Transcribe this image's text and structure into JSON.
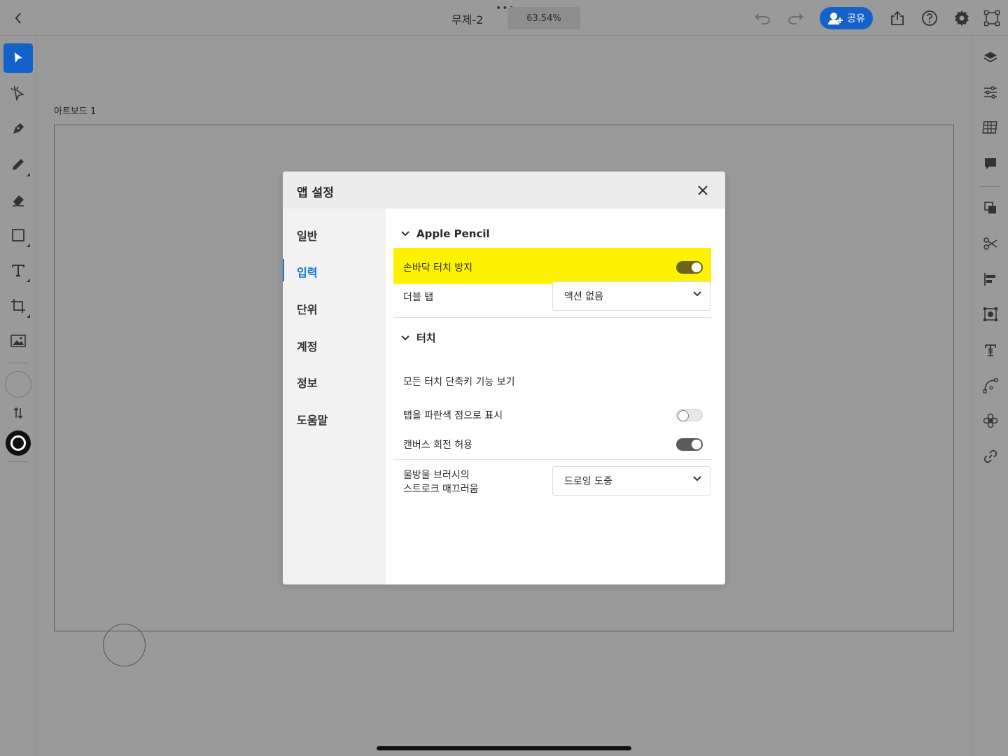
{
  "topbar": {
    "title": "무제-2",
    "more": "•••",
    "zoom": "63.54%",
    "share_label": "공유"
  },
  "canvas": {
    "artboard_label": "아트보드 1"
  },
  "dialog": {
    "title": "앱 설정",
    "nav": [
      "일반",
      "입력",
      "단위",
      "계정",
      "정보",
      "도움말"
    ],
    "active_nav": "입력",
    "sections": {
      "apple_pencil": {
        "title": "Apple Pencil",
        "palm_rejection_label": "손바닥 터치 방지",
        "palm_rejection_on": true,
        "double_tap_label": "더블 탭",
        "double_tap_value": "액션 없음"
      },
      "touch": {
        "title": "터치",
        "view_shortcuts_label": "모든 터치 단축키 기능 보기",
        "show_taps_label": "탭을 파란색 점으로 표시",
        "show_taps_on": false,
        "canvas_rotation_label": "캔버스 회전 허용",
        "canvas_rotation_on": true,
        "smoothing_label_line1": "물방울 브러시의",
        "smoothing_label_line2": "스트로크 매끄러움",
        "smoothing_value": "드로잉 도중"
      }
    }
  },
  "colors": {
    "accent": "#1473e6",
    "share": "#1461c9",
    "highlight": "#fff200"
  }
}
